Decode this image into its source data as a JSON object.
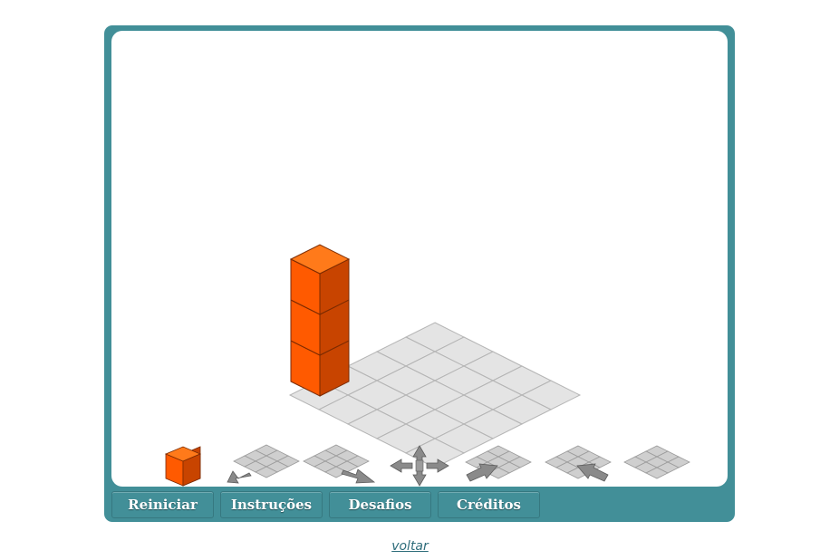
{
  "game": {
    "grid_size": 5,
    "tower_height": 3,
    "colors": {
      "frame": "#428f98",
      "cube_top": "#ff7a1a",
      "cube_left": "#ff5a00",
      "cube_right": "#c84400",
      "grid_fill": "#e4e4e4",
      "grid_line": "#b4b4b4",
      "tool_gray": "#8a8a8a"
    }
  },
  "toolbar": {
    "tools": [
      {
        "name": "add-cube-tool",
        "icon": "orange-cube-icon"
      },
      {
        "name": "rotate-left-tool",
        "icon": "grid-arrow-down-left-icon"
      },
      {
        "name": "rotate-right-tool",
        "icon": "grid-arrow-down-right-icon"
      },
      {
        "name": "move-tool",
        "icon": "four-way-arrow-icon"
      },
      {
        "name": "view-front-tool",
        "icon": "grid-arrow-up-right-icon"
      },
      {
        "name": "view-side-tool",
        "icon": "grid-arrow-up-left-icon"
      },
      {
        "name": "view-top-tool",
        "icon": "grid-plain-icon"
      }
    ]
  },
  "buttons": {
    "reiniciar": "Reiniciar",
    "instrucoes": "Instruções",
    "desafios": "Desafios",
    "creditos": "Créditos"
  },
  "footer": {
    "back_link": "voltar"
  }
}
